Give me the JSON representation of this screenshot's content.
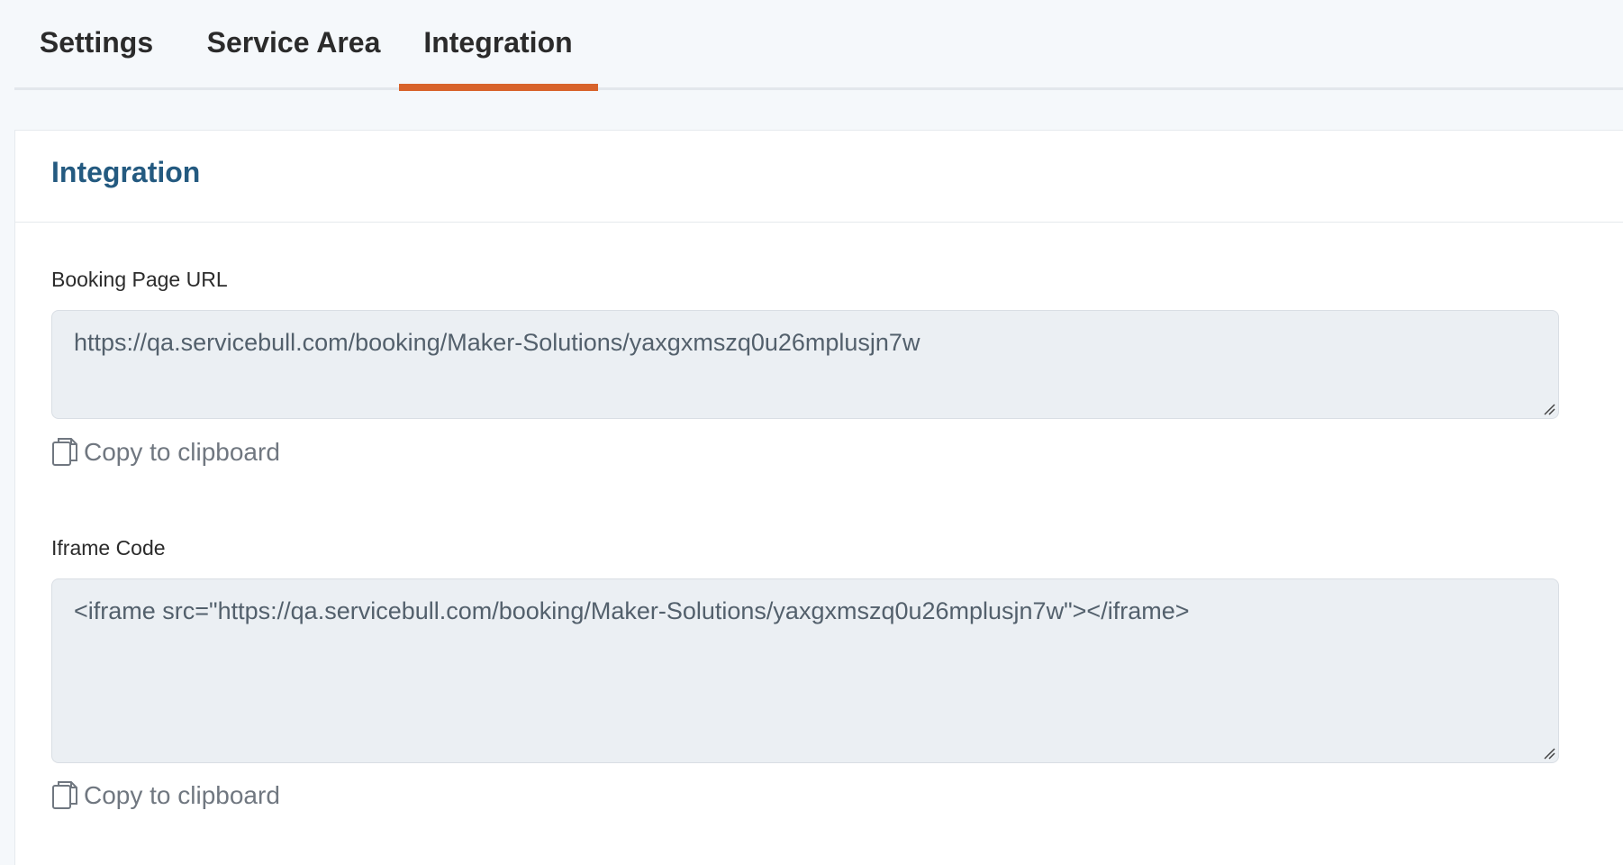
{
  "tabs": [
    {
      "label": "Settings",
      "active": false
    },
    {
      "label": "Service Area",
      "active": false
    },
    {
      "label": "Integration",
      "active": true
    }
  ],
  "accent_color": "#d8632b",
  "title_color": "#245a80",
  "card": {
    "title": "Integration",
    "booking_url": {
      "label": "Booking Page URL",
      "value": "https://qa.servicebull.com/booking/Maker-Solutions/yaxgxmszq0u26mplusjn7w",
      "copy_label": "Copy to clipboard",
      "copy_icon": "copy-icon"
    },
    "iframe_code": {
      "label": "Iframe Code",
      "value": "<iframe src=\"https://qa.servicebull.com/booking/Maker-Solutions/yaxgxmszq0u26mplusjn7w\"></iframe>",
      "copy_label": "Copy to clipboard",
      "copy_icon": "copy-icon"
    }
  }
}
